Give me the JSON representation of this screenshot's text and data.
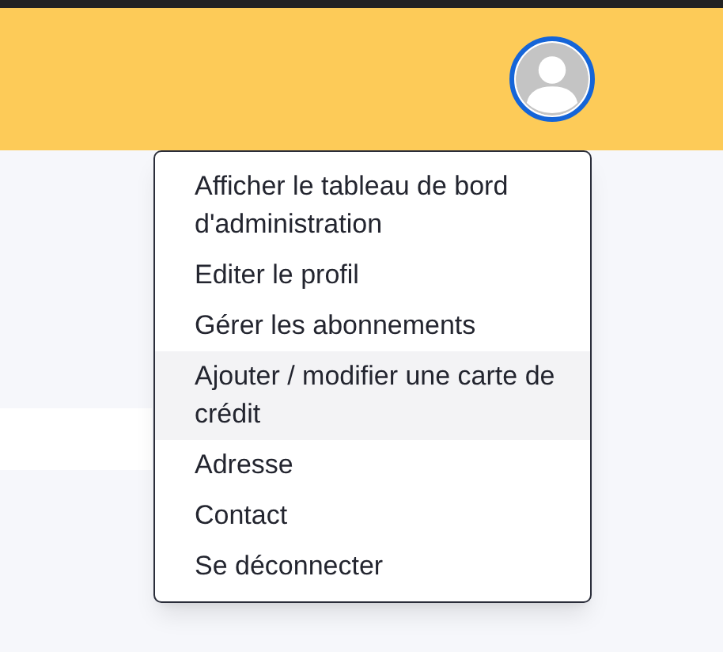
{
  "header": {
    "avatar": {
      "kind": "placeholder"
    }
  },
  "user_menu": {
    "items": [
      {
        "label": "Afficher le tableau de bord d'administration",
        "selected": false
      },
      {
        "label": "Editer le profil",
        "selected": false
      },
      {
        "label": "Gérer les abonnements",
        "selected": false
      },
      {
        "label": "Ajouter / modifier une carte de crédit",
        "selected": true
      },
      {
        "label": "Adresse",
        "selected": false
      },
      {
        "label": "Contact",
        "selected": false
      },
      {
        "label": "Se déconnecter",
        "selected": false
      }
    ]
  }
}
